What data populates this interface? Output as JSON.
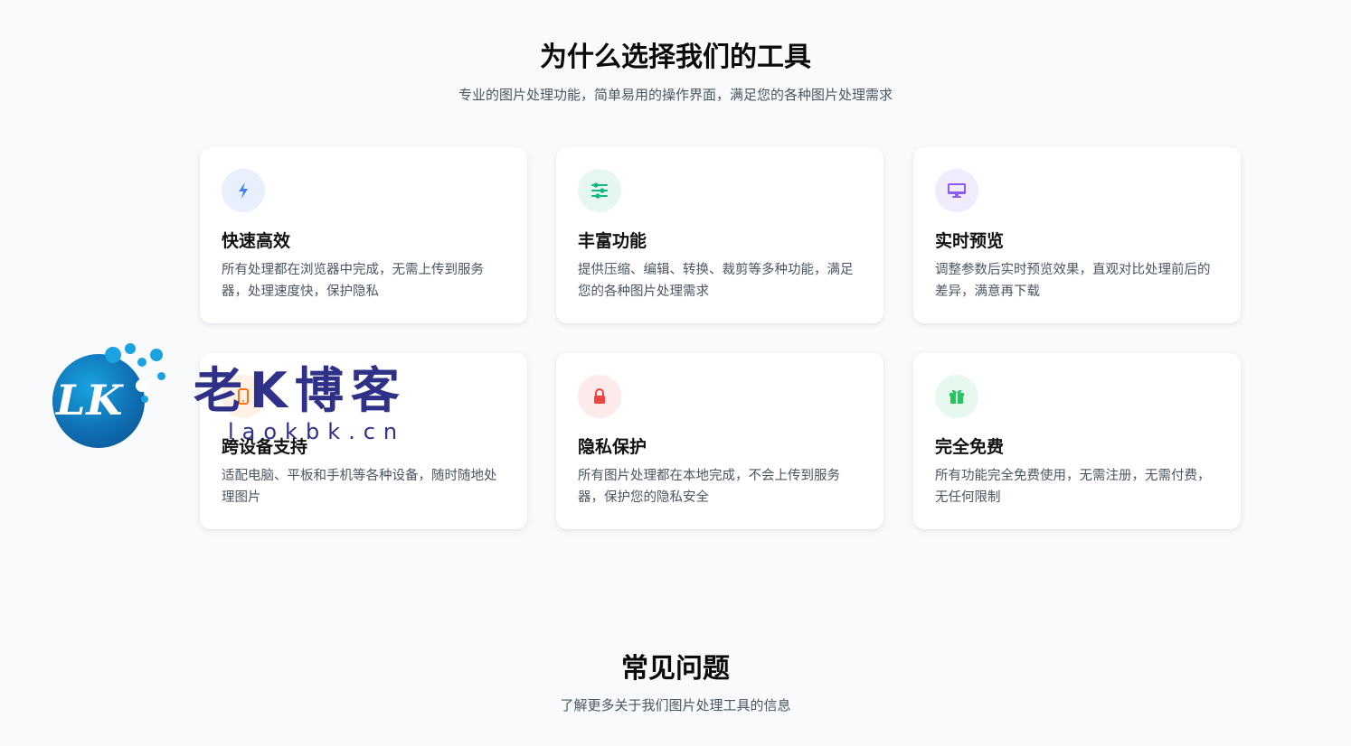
{
  "why_section": {
    "title": "为什么选择我们的工具",
    "subtitle": "专业的图片处理功能，简单易用的操作界面，满足您的各种图片处理需求"
  },
  "features": [
    {
      "icon": "lightning-icon",
      "icon_color": "#3b82f6",
      "icon_bg": "#e8f0fe",
      "title": "快速高效",
      "description": "所有处理都在浏览器中完成，无需上传到服务器，处理速度快，保护隐私"
    },
    {
      "icon": "sliders-icon",
      "icon_color": "#10b981",
      "icon_bg": "#e6f7f1",
      "title": "丰富功能",
      "description": "提供压缩、编辑、转换、裁剪等多种功能，满足您的各种图片处理需求"
    },
    {
      "icon": "monitor-icon",
      "icon_color": "#8b5cf6",
      "icon_bg": "#f1ebfe",
      "title": "实时预览",
      "description": "调整参数后实时预览效果，直观对比处理前后的差异，满意再下载"
    },
    {
      "icon": "mobile-icon",
      "icon_color": "#f97316",
      "icon_bg": "#fff1e6",
      "title": "跨设备支持",
      "description": "适配电脑、平板和手机等各种设备，随时随地处理图片"
    },
    {
      "icon": "lock-icon",
      "icon_color": "#ef4444",
      "icon_bg": "#fdeaea",
      "title": "隐私保护",
      "description": "所有图片处理都在本地完成，不会上传到服务器，保护您的隐私安全"
    },
    {
      "icon": "gift-icon",
      "icon_color": "#22c55e",
      "icon_bg": "#e7f8ee",
      "title": "完全免费",
      "description": "所有功能完全免费使用，无需注册，无需付费，无任何限制"
    }
  ],
  "faq_section": {
    "title": "常见问题",
    "subtitle": "了解更多关于我们图片处理工具的信息"
  },
  "watermark": {
    "logo_letters": "LK",
    "name": "老K博客",
    "url": "laokbk.cn"
  }
}
